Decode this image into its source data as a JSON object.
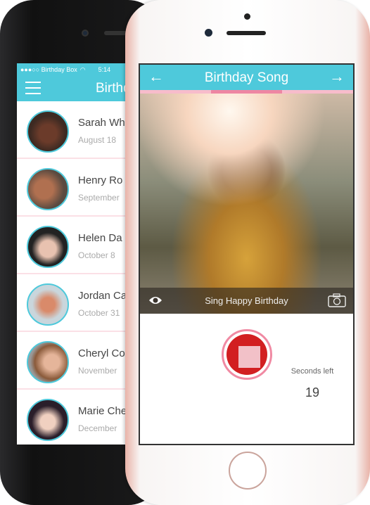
{
  "back_phone": {
    "status": {
      "carrier": "●●●○○ Birthday Box",
      "time": "5:14"
    },
    "header": {
      "title": "Birthd"
    },
    "contacts": [
      {
        "name": "Sarah Wh",
        "date": "August 18"
      },
      {
        "name": "Henry Ro",
        "date": "September"
      },
      {
        "name": "Helen Da",
        "date": "October 8"
      },
      {
        "name": "Jordan Ca",
        "date": "October 31"
      },
      {
        "name": "Cheryl Co",
        "date": "November"
      },
      {
        "name": "Marie Che",
        "date": "December"
      }
    ]
  },
  "front_phone": {
    "header": {
      "title": "Birthday Song",
      "back_icon": "arrow-left-icon",
      "next_icon": "arrow-right-icon"
    },
    "step_progress": {
      "current": 2,
      "total": 3
    },
    "caption": "Sing Happy Birthday",
    "seconds_left_label": "Seconds left",
    "seconds_left_value": "19"
  },
  "colors": {
    "accent": "#4ec9db",
    "pink": "#ee87a3",
    "record": "#d21f21"
  }
}
